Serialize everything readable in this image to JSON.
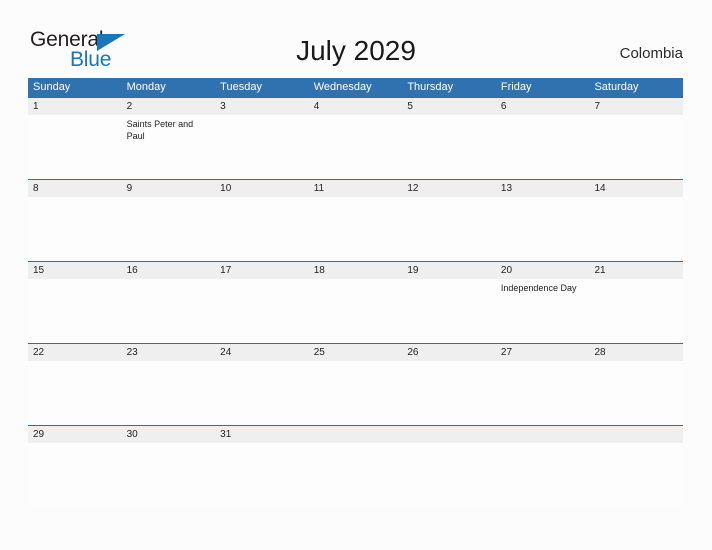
{
  "brand": {
    "word_one": "General",
    "word_two": "Blue",
    "flag_icon": "flag-triangle-icon",
    "color_dark": "#231f20",
    "color_blue": "#1b75bb"
  },
  "header": {
    "title": "July 2029",
    "country": "Colombia"
  },
  "theme": {
    "header_blue": "#3071b0",
    "date_row_bg": "#efefef",
    "separator_blue": "#2f6fa8",
    "page_bg": "#fcfcfd"
  },
  "calendar": {
    "weekdays": [
      "Sunday",
      "Monday",
      "Tuesday",
      "Wednesday",
      "Thursday",
      "Friday",
      "Saturday"
    ],
    "weeks": [
      {
        "dates": [
          "1",
          "2",
          "3",
          "4",
          "5",
          "6",
          "7"
        ],
        "events": [
          "",
          "Saints Peter and Paul",
          "",
          "",
          "",
          "",
          ""
        ]
      },
      {
        "dates": [
          "8",
          "9",
          "10",
          "11",
          "12",
          "13",
          "14"
        ],
        "events": [
          "",
          "",
          "",
          "",
          "",
          "",
          ""
        ]
      },
      {
        "dates": [
          "15",
          "16",
          "17",
          "18",
          "19",
          "20",
          "21"
        ],
        "events": [
          "",
          "",
          "",
          "",
          "",
          "Independence Day",
          ""
        ]
      },
      {
        "dates": [
          "22",
          "23",
          "24",
          "25",
          "26",
          "27",
          "28"
        ],
        "events": [
          "",
          "",
          "",
          "",
          "",
          "",
          ""
        ]
      },
      {
        "dates": [
          "29",
          "30",
          "31",
          "",
          "",
          "",
          ""
        ],
        "events": [
          "",
          "",
          "",
          "",
          "",
          "",
          ""
        ]
      }
    ]
  }
}
